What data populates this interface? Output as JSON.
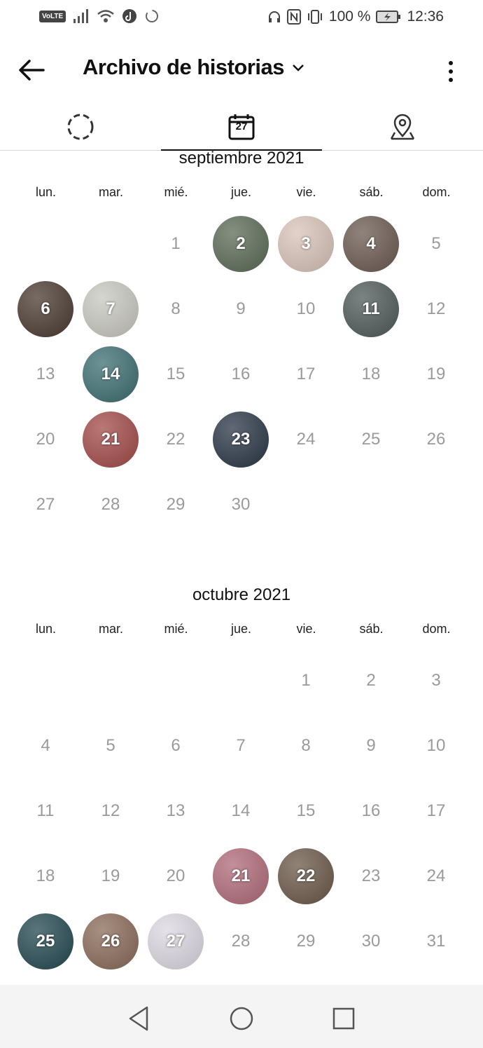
{
  "status_bar": {
    "network_badge": "VoLTE",
    "battery": "100 %",
    "time": "12:36",
    "icons": [
      "signal-icon",
      "wifi-icon",
      "tiktok-icon",
      "sync-icon",
      "headphones-icon",
      "nfc-icon",
      "vibrate-icon",
      "battery-charging-icon"
    ]
  },
  "appbar": {
    "title": "Archivo de historias",
    "icons": [
      "back-arrow-icon",
      "chevron-down-icon",
      "more-vert-icon"
    ]
  },
  "tabs": [
    {
      "icon": "stories-circle-icon",
      "active": false
    },
    {
      "icon": "calendar-icon",
      "label": "27",
      "active": true
    },
    {
      "icon": "location-pin-icon",
      "active": false
    }
  ],
  "weekdays": [
    "lun.",
    "mar.",
    "mié.",
    "jue.",
    "vie.",
    "sáb.",
    "dom."
  ],
  "months": [
    {
      "title": "septiembre 2021",
      "first_weekday": 2,
      "days": 30,
      "stories": {
        "2": "#5b6a55",
        "3": "#d8c3b8",
        "4": "#6b5a50",
        "6": "#4a3a30",
        "7": "#c8c8c0",
        "11": "#4e5a58",
        "14": "#3d6e72",
        "21": "#a24a48",
        "23": "#2a3646"
      }
    },
    {
      "title": "octubre 2021",
      "first_weekday": 4,
      "days": 31,
      "stories": {
        "21": "#b06a78",
        "22": "#6b5848",
        "25": "#234850",
        "26": "#8a6a58",
        "27": "#dcd8e2"
      }
    }
  ],
  "nav_bar": {
    "icons": [
      "back-triangle-icon",
      "home-circle-icon",
      "recents-square-icon"
    ]
  }
}
